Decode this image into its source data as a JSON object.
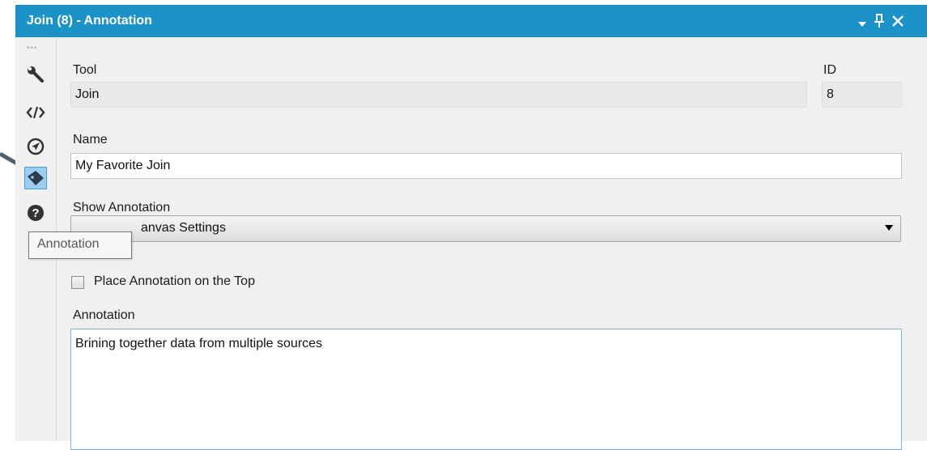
{
  "window": {
    "title": "Join (8) - Annotation",
    "title_bar_color": "#1b93c8",
    "controls": [
      "dropdown-arrow-icon",
      "pin-icon",
      "close-icon"
    ]
  },
  "sidebar": {
    "items": [
      {
        "icon": "wrench-icon",
        "tooltip": ""
      },
      {
        "icon": "code-icon",
        "tooltip": ""
      },
      {
        "icon": "compass-icon",
        "tooltip": ""
      },
      {
        "icon": "annotation-tag-icon",
        "tooltip": "Annotation",
        "active": true
      },
      {
        "icon": "help-icon",
        "tooltip": ""
      }
    ]
  },
  "tooltip": {
    "text": "Annotation"
  },
  "form": {
    "tool_label": "Tool",
    "tool_value": "Join",
    "id_label": "ID",
    "id_value": "8",
    "name_label": "Name",
    "name_value": "My Favorite Join",
    "show_annotation_label": "Show Annotation",
    "show_annotation_value": "anvas Settings",
    "place_on_top_label": "Place Annotation on the Top",
    "place_on_top_checked": false,
    "annotation_label": "Annotation",
    "annotation_value": "Brining together data from multiple sources"
  }
}
